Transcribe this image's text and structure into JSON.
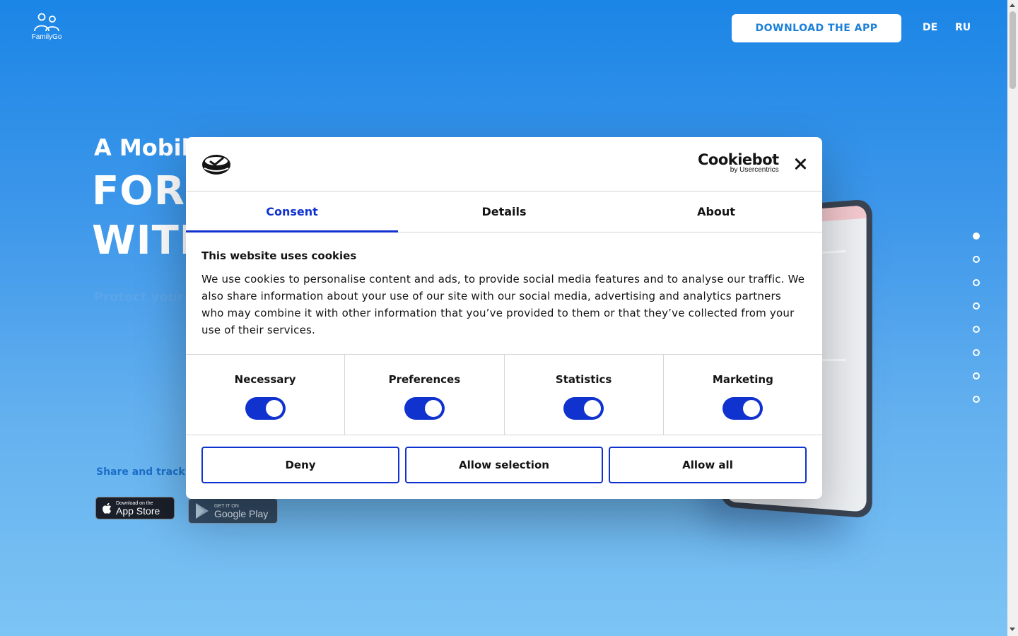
{
  "header": {
    "logo_text": "FamilyGo",
    "download_label": "DOWNLOAD THE APP",
    "languages": [
      "DE",
      "RU"
    ]
  },
  "hero": {
    "subtitle": "A Mobile",
    "line1": "FOR S",
    "line2": "WITH",
    "protect_text": "Protect your lo",
    "share_text": "Share and track loc",
    "app_store": {
      "small": "Download on the",
      "big": "App Store"
    },
    "google_play": {
      "small": "GET IT ON",
      "big": "Google Play"
    }
  },
  "pagination": {
    "count": 8,
    "active_index": 0
  },
  "cookie_dialog": {
    "brand": "Cookiebot",
    "brand_sub": "by Usercentrics",
    "tabs": [
      "Consent",
      "Details",
      "About"
    ],
    "active_tab": "Consent",
    "title": "This website uses cookies",
    "text": "We use cookies to personalise content and ads, to provide social media features and to analyse our traffic. We also share information about your use of our site with our social media, advertising and analytics partners who may combine it with other information that you’ve provided to them or that they’ve collected from your use of their services.",
    "categories": [
      {
        "label": "Necessary",
        "enabled": true
      },
      {
        "label": "Preferences",
        "enabled": true
      },
      {
        "label": "Statistics",
        "enabled": true
      },
      {
        "label": "Marketing",
        "enabled": true
      }
    ],
    "buttons": {
      "deny": "Deny",
      "allow_selection": "Allow selection",
      "allow_all": "Allow all"
    }
  },
  "colors": {
    "accent": "#1032cf",
    "hero_blue": "#1b85e6",
    "download_text": "#1b7fd8"
  }
}
